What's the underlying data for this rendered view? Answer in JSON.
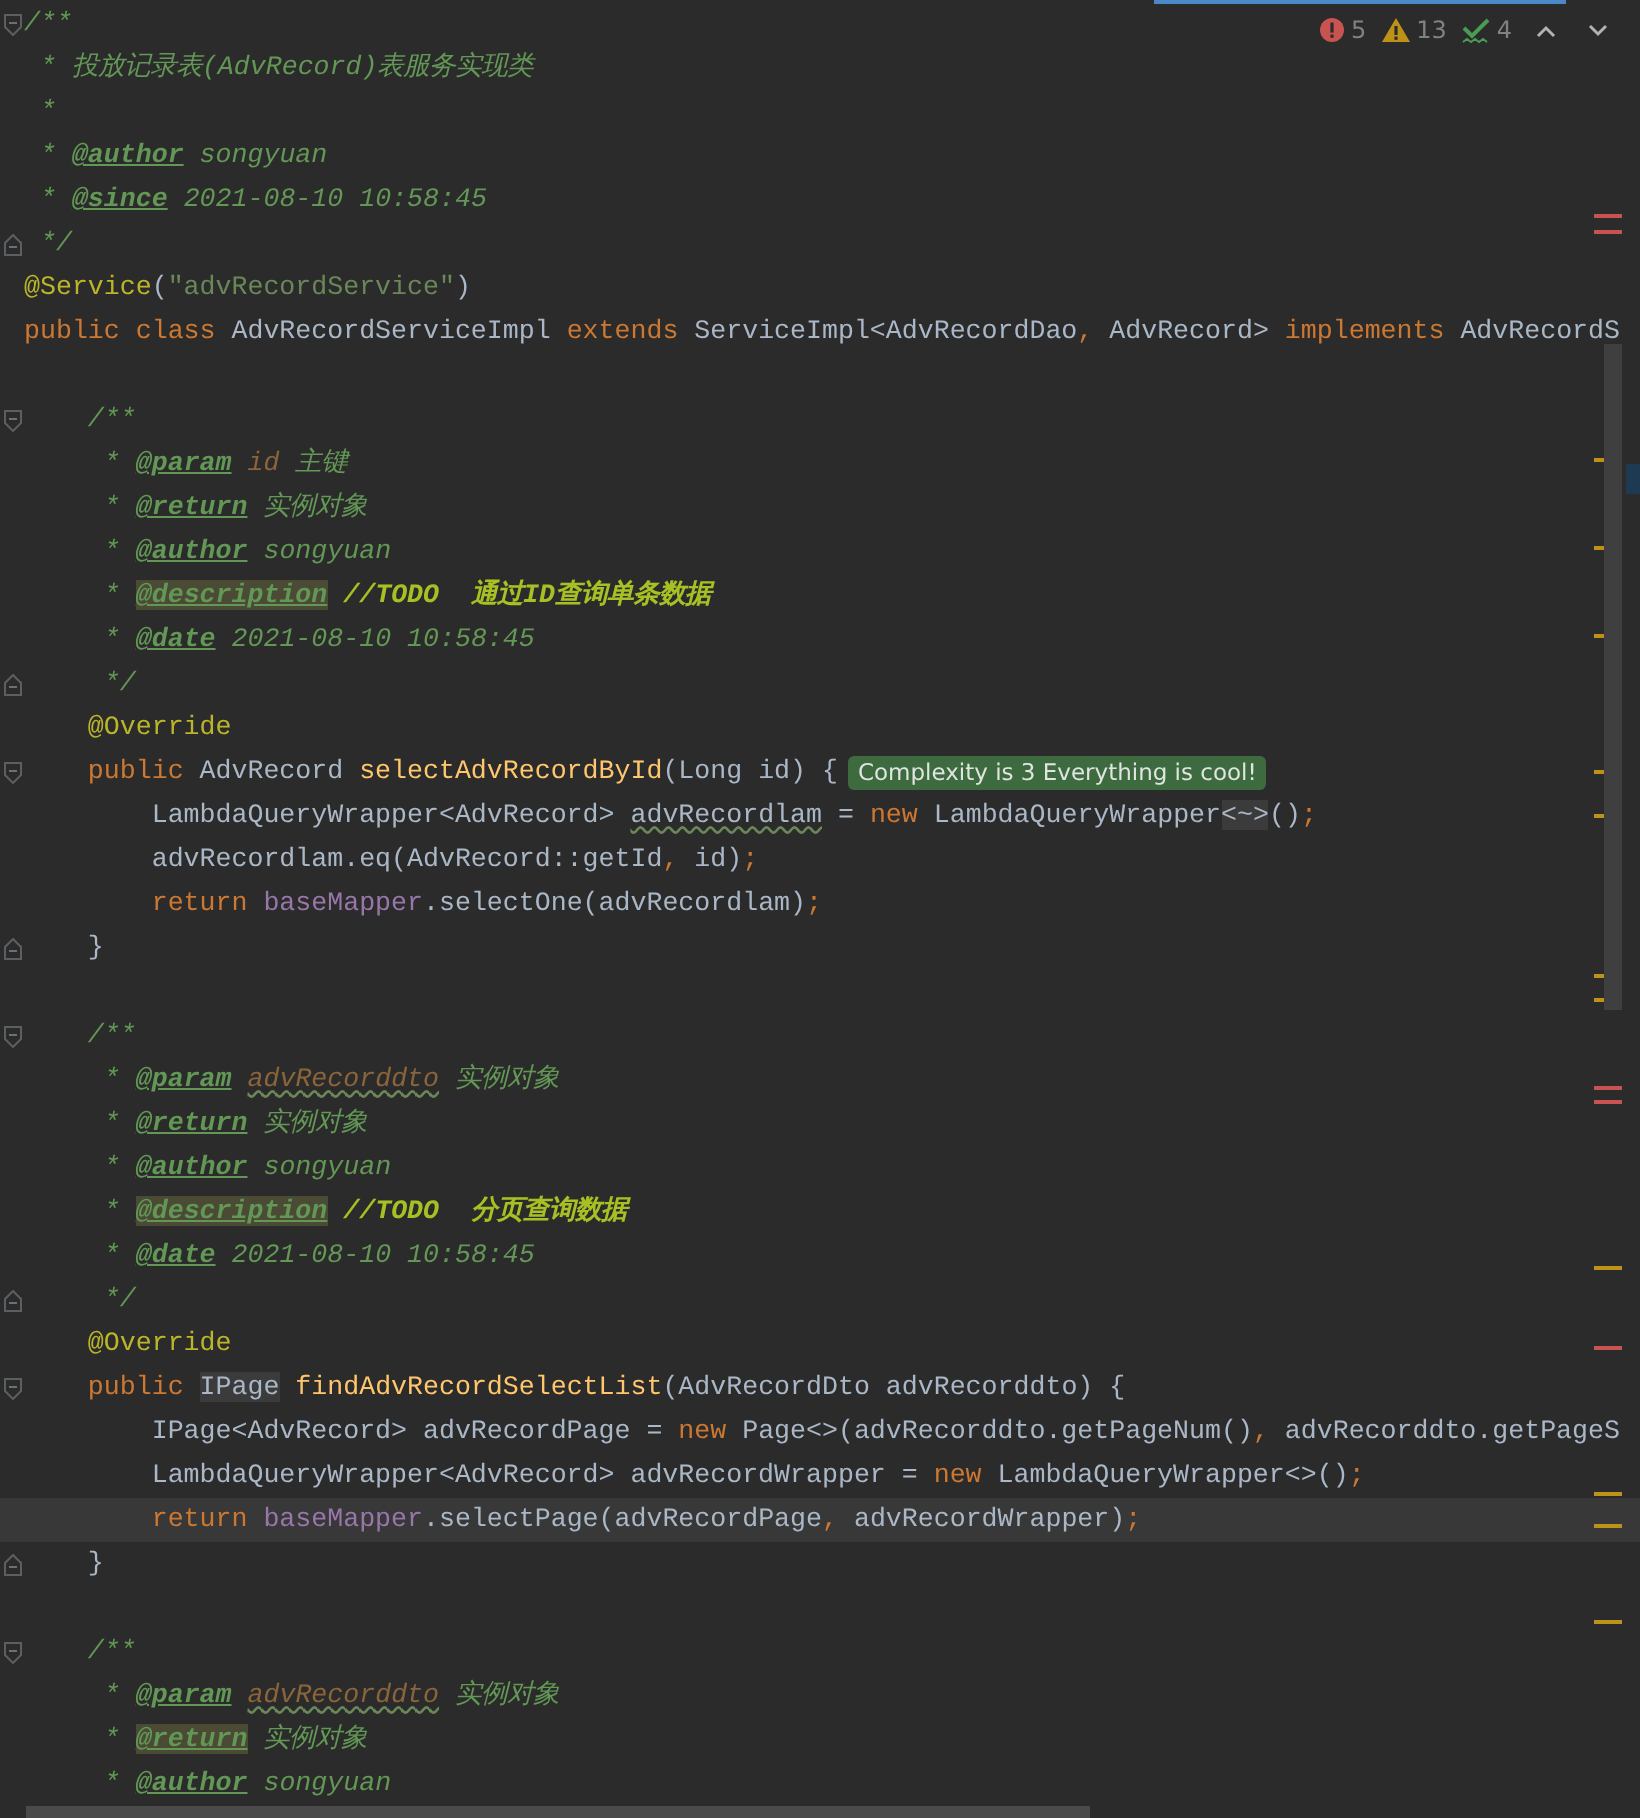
{
  "inspections": [
    {
      "kind": "error",
      "count": "5"
    },
    {
      "kind": "warning",
      "count": "13"
    },
    {
      "kind": "ok",
      "count": "4"
    }
  ],
  "lines": [
    {
      "kind": "code",
      "current": false,
      "fold": {
        "kind": "start"
      },
      "tokens": [
        {
          "text": "/**",
          "kind": "comment"
        }
      ]
    },
    {
      "kind": "code",
      "current": false,
      "tokens": [
        {
          "text": " * 投放记录表(AdvRecord)表服务实现类",
          "kind": "comment"
        }
      ]
    },
    {
      "kind": "code",
      "current": false,
      "tokens": [
        {
          "text": " *",
          "kind": "comment"
        }
      ]
    },
    {
      "kind": "code",
      "current": false,
      "tokens": [
        {
          "text": " * ",
          "kind": "comment"
        },
        {
          "text": "@author",
          "kind": "tag"
        },
        {
          "text": " songyuan",
          "kind": "comment"
        }
      ]
    },
    {
      "kind": "code",
      "current": false,
      "tokens": [
        {
          "text": " * ",
          "kind": "comment"
        },
        {
          "text": "@since",
          "kind": "tag"
        },
        {
          "text": " 2021-08-10 10:58:45",
          "kind": "comment"
        }
      ]
    },
    {
      "kind": "code",
      "current": false,
      "fold": {
        "kind": "end"
      },
      "tokens": [
        {
          "text": " */",
          "kind": "comment"
        }
      ]
    },
    {
      "kind": "code",
      "current": false,
      "tokens": [
        {
          "text": "@Service",
          "kind": "annotation"
        },
        {
          "text": "(",
          "kind": "plain"
        },
        {
          "text": "\"advRecordService\"",
          "kind": "string"
        },
        {
          "text": ")",
          "kind": "plain"
        }
      ]
    },
    {
      "kind": "code",
      "current": false,
      "tokens": [
        {
          "text": "public class ",
          "kind": "keyword"
        },
        {
          "text": "AdvRecordServiceImpl ",
          "kind": "plain"
        },
        {
          "text": "extends ",
          "kind": "keyword"
        },
        {
          "text": "ServiceImpl<AdvRecordDao",
          "kind": "plain"
        },
        {
          "text": ", ",
          "kind": "keyword"
        },
        {
          "text": "AdvRecord> ",
          "kind": "plain"
        },
        {
          "text": "implements ",
          "kind": "keyword"
        },
        {
          "text": "AdvRecordS",
          "kind": "plain"
        }
      ]
    },
    {
      "kind": "blank"
    },
    {
      "kind": "code",
      "current": false,
      "fold": {
        "kind": "start"
      },
      "tokens": [
        {
          "text": "    /**",
          "kind": "comment"
        }
      ]
    },
    {
      "kind": "code",
      "current": false,
      "tokens": [
        {
          "text": "     * ",
          "kind": "comment"
        },
        {
          "text": "@param",
          "kind": "tag"
        },
        {
          "text": " id",
          "kind": "doc_param"
        },
        {
          "text": " 主键",
          "kind": "comment"
        }
      ]
    },
    {
      "kind": "code",
      "current": false,
      "tokens": [
        {
          "text": "     * ",
          "kind": "comment"
        },
        {
          "text": "@return",
          "kind": "tag"
        },
        {
          "text": " 实例对象",
          "kind": "comment"
        }
      ]
    },
    {
      "kind": "code",
      "current": false,
      "tokens": [
        {
          "text": "     * ",
          "kind": "comment"
        },
        {
          "text": "@author",
          "kind": "tag"
        },
        {
          "text": " songyuan",
          "kind": "comment"
        }
      ]
    },
    {
      "kind": "code",
      "current": false,
      "tokens": [
        {
          "text": "     * ",
          "kind": "comment"
        },
        {
          "text": "@description",
          "kind": "tag_marked"
        },
        {
          "text": " //TODO  通过ID查询单条数据",
          "kind": "todo"
        }
      ]
    },
    {
      "kind": "code",
      "current": false,
      "tokens": [
        {
          "text": "     * ",
          "kind": "comment"
        },
        {
          "text": "@date",
          "kind": "tag"
        },
        {
          "text": " 2021-08-10 10:58:45",
          "kind": "comment"
        }
      ]
    },
    {
      "kind": "code",
      "current": false,
      "fold": {
        "kind": "end"
      },
      "tokens": [
        {
          "text": "     */",
          "kind": "comment"
        }
      ]
    },
    {
      "kind": "code",
      "current": false,
      "tokens": [
        {
          "text": "    @Override",
          "kind": "annotation"
        }
      ]
    },
    {
      "kind": "code",
      "current": false,
      "fold": {
        "kind": "start"
      },
      "hint": "Complexity is 3 Everything is cool!",
      "tokens": [
        {
          "text": "    public ",
          "kind": "keyword"
        },
        {
          "text": "AdvRecord ",
          "kind": "plain"
        },
        {
          "text": "selectAdvRecordById",
          "kind": "method"
        },
        {
          "text": "(Long id) {",
          "kind": "plain"
        }
      ]
    },
    {
      "kind": "code",
      "current": false,
      "tokens": [
        {
          "text": "        LambdaQueryWrapper<AdvRecord> ",
          "kind": "plain"
        },
        {
          "text": "advRecordlam",
          "kind": "plain_warn"
        },
        {
          "text": " = ",
          "kind": "plain"
        },
        {
          "text": "new ",
          "kind": "keyword"
        },
        {
          "text": "LambdaQueryWrapper",
          "kind": "plain"
        },
        {
          "text": "<~>",
          "kind": "plain_marked"
        },
        {
          "text": "()",
          "kind": "plain"
        },
        {
          "text": ";",
          "kind": "keyword"
        }
      ]
    },
    {
      "kind": "code",
      "current": false,
      "tokens": [
        {
          "text": "        advRecordlam.eq(AdvRecord::getId",
          "kind": "plain"
        },
        {
          "text": ", ",
          "kind": "keyword"
        },
        {
          "text": "id)",
          "kind": "plain"
        },
        {
          "text": ";",
          "kind": "keyword"
        }
      ]
    },
    {
      "kind": "code",
      "current": false,
      "tokens": [
        {
          "text": "        return ",
          "kind": "keyword"
        },
        {
          "text": "baseMapper",
          "kind": "field"
        },
        {
          "text": ".selectOne(advRecordlam)",
          "kind": "plain"
        },
        {
          "text": ";",
          "kind": "keyword"
        }
      ]
    },
    {
      "kind": "code",
      "current": false,
      "fold": {
        "kind": "end"
      },
      "tokens": [
        {
          "text": "    }",
          "kind": "plain"
        }
      ]
    },
    {
      "kind": "blank"
    },
    {
      "kind": "code",
      "current": false,
      "fold": {
        "kind": "start"
      },
      "tokens": [
        {
          "text": "    /**",
          "kind": "comment"
        }
      ]
    },
    {
      "kind": "code",
      "current": false,
      "tokens": [
        {
          "text": "     * ",
          "kind": "comment"
        },
        {
          "text": "@param",
          "kind": "tag"
        },
        {
          "text": " advRecorddto",
          "kind": "doc_param_warn"
        },
        {
          "text": " 实例对象",
          "kind": "comment"
        }
      ]
    },
    {
      "kind": "code",
      "current": false,
      "tokens": [
        {
          "text": "     * ",
          "kind": "comment"
        },
        {
          "text": "@return",
          "kind": "tag"
        },
        {
          "text": " 实例对象",
          "kind": "comment"
        }
      ]
    },
    {
      "kind": "code",
      "current": false,
      "tokens": [
        {
          "text": "     * ",
          "kind": "comment"
        },
        {
          "text": "@author",
          "kind": "tag"
        },
        {
          "text": " songyuan",
          "kind": "comment"
        }
      ]
    },
    {
      "kind": "code",
      "current": false,
      "tokens": [
        {
          "text": "     * ",
          "kind": "comment"
        },
        {
          "text": "@description",
          "kind": "tag_marked"
        },
        {
          "text": " //TODO  分页查询数据",
          "kind": "todo"
        }
      ]
    },
    {
      "kind": "code",
      "current": false,
      "tokens": [
        {
          "text": "     * ",
          "kind": "comment"
        },
        {
          "text": "@date",
          "kind": "tag"
        },
        {
          "text": " 2021-08-10 10:58:45",
          "kind": "comment"
        }
      ]
    },
    {
      "kind": "code",
      "current": false,
      "fold": {
        "kind": "end"
      },
      "tokens": [
        {
          "text": "     */",
          "kind": "comment"
        }
      ]
    },
    {
      "kind": "code",
      "current": false,
      "tokens": [
        {
          "text": "    @Override",
          "kind": "annotation"
        }
      ]
    },
    {
      "kind": "code",
      "current": false,
      "fold": {
        "kind": "start"
      },
      "tokens": [
        {
          "text": "    public ",
          "kind": "keyword"
        },
        {
          "text": "IPage",
          "kind": "plain_marked"
        },
        {
          "text": " findAdvRecordSelectList",
          "kind": "method"
        },
        {
          "text": "(AdvRecordDto advRecorddto) {",
          "kind": "plain"
        }
      ]
    },
    {
      "kind": "code",
      "current": false,
      "tokens": [
        {
          "text": "        IPage<AdvRecord> advRecordPage = ",
          "kind": "plain"
        },
        {
          "text": "new ",
          "kind": "keyword"
        },
        {
          "text": "Page<>(advRecorddto.getPageNum()",
          "kind": "plain"
        },
        {
          "text": ", ",
          "kind": "keyword"
        },
        {
          "text": "advRecorddto.getPageS",
          "kind": "plain"
        }
      ]
    },
    {
      "kind": "code",
      "current": false,
      "tokens": [
        {
          "text": "        LambdaQueryWrapper<AdvRecord> advRecordWrapper = ",
          "kind": "plain"
        },
        {
          "text": "new ",
          "kind": "keyword"
        },
        {
          "text": "LambdaQueryWrapper<>()",
          "kind": "plain"
        },
        {
          "text": ";",
          "kind": "keyword"
        }
      ]
    },
    {
      "kind": "code",
      "current": true,
      "tokens": [
        {
          "text": "        return ",
          "kind": "keyword"
        },
        {
          "text": "baseMapper",
          "kind": "field"
        },
        {
          "text": ".selectPage(advRecordPage",
          "kind": "plain"
        },
        {
          "text": ", ",
          "kind": "keyword"
        },
        {
          "text": "advRecordWrapper)",
          "kind": "plain"
        },
        {
          "text": ";",
          "kind": "keyword"
        }
      ]
    },
    {
      "kind": "code",
      "current": false,
      "fold": {
        "kind": "end"
      },
      "tokens": [
        {
          "text": "    }",
          "kind": "plain"
        }
      ]
    },
    {
      "kind": "blank"
    },
    {
      "kind": "code",
      "current": false,
      "fold": {
        "kind": "start"
      },
      "tokens": [
        {
          "text": "    /**",
          "kind": "comment"
        }
      ]
    },
    {
      "kind": "code",
      "current": false,
      "tokens": [
        {
          "text": "     * ",
          "kind": "comment"
        },
        {
          "text": "@param",
          "kind": "tag"
        },
        {
          "text": " advRecorddto",
          "kind": "doc_param_warn"
        },
        {
          "text": " 实例对象",
          "kind": "comment"
        }
      ]
    },
    {
      "kind": "code",
      "current": false,
      "tokens": [
        {
          "text": "     * ",
          "kind": "comment"
        },
        {
          "text": "@return",
          "kind": "tag_marked"
        },
        {
          "text": " 实例对象",
          "kind": "comment"
        }
      ]
    },
    {
      "kind": "code",
      "current": false,
      "tokens": [
        {
          "text": "     * ",
          "kind": "comment"
        },
        {
          "text": "@author",
          "kind": "tag"
        },
        {
          "text": " songyuan",
          "kind": "comment"
        }
      ]
    }
  ]
}
